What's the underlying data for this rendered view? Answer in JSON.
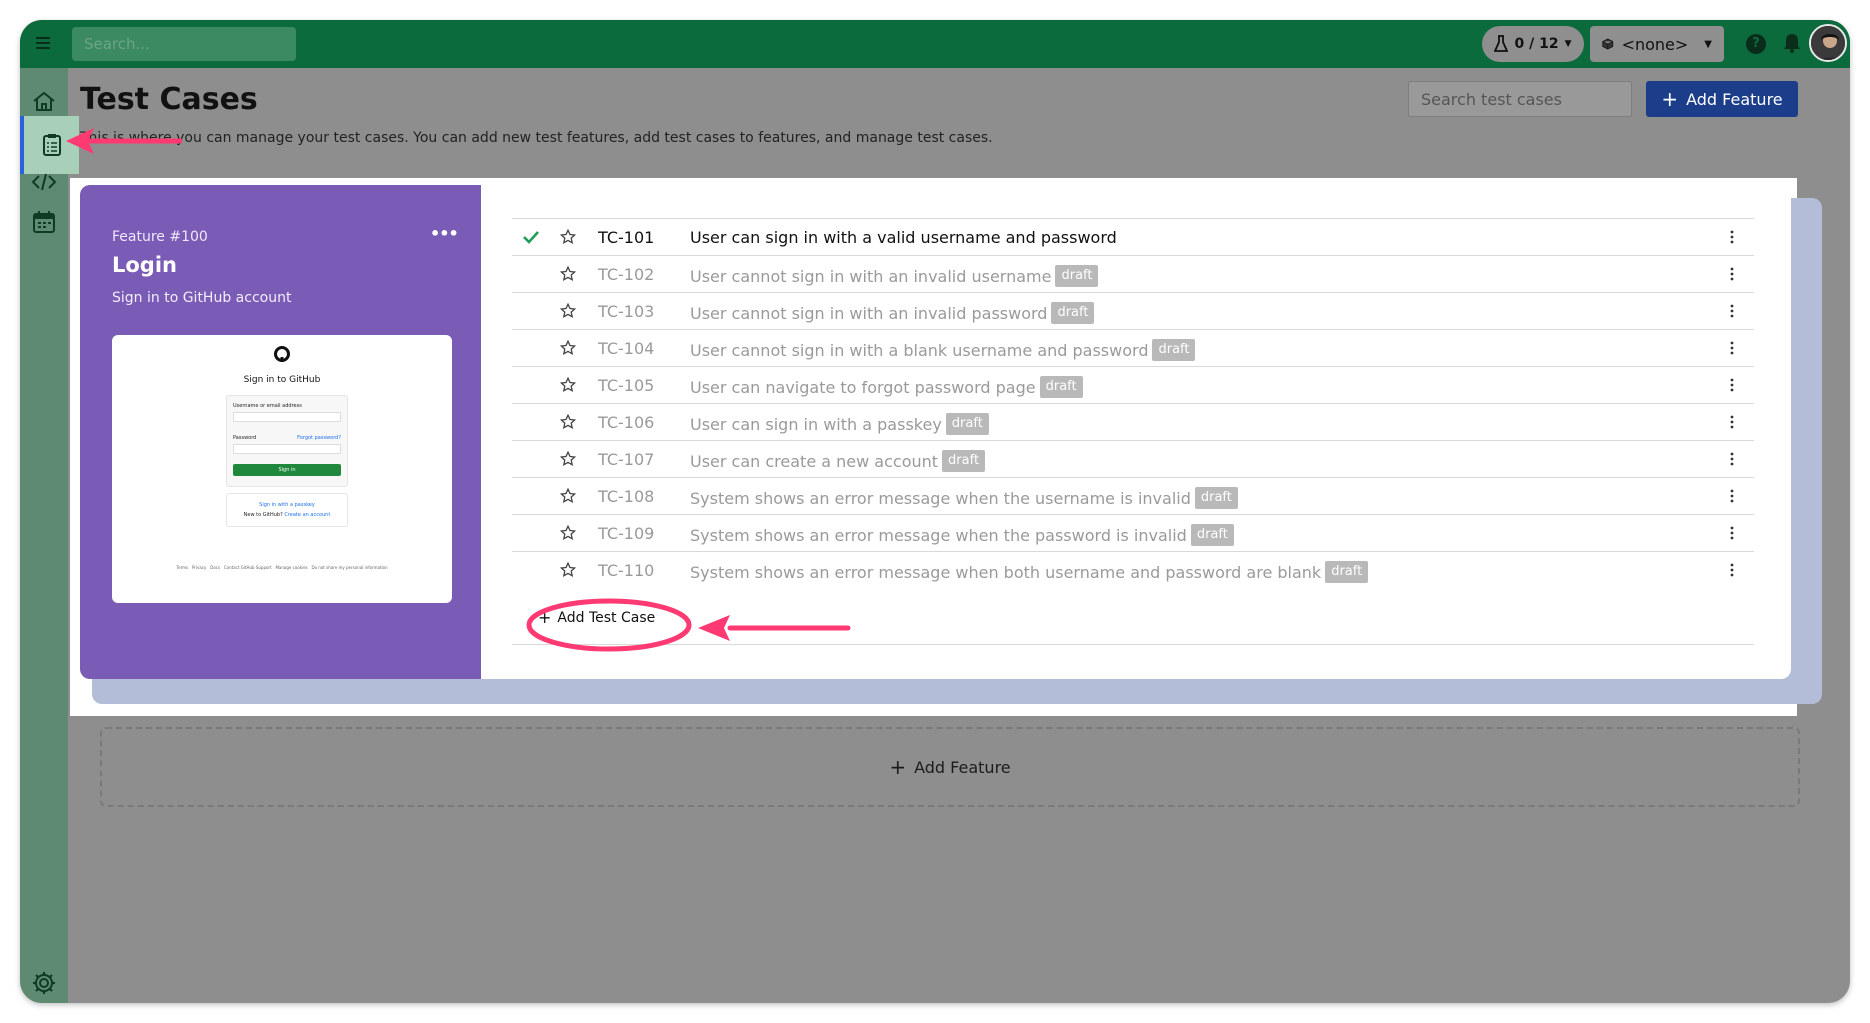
{
  "topbar": {
    "search_placeholder": "Search...",
    "runs_label": "0 / 12",
    "environment_label": "<none>",
    "help_label": "?"
  },
  "sidebar": {
    "items": [
      {
        "name": "home",
        "icon": "home-icon"
      },
      {
        "name": "test-cases",
        "icon": "clipboard-icon",
        "active": true
      },
      {
        "name": "code",
        "icon": "code-icon"
      },
      {
        "name": "calendar",
        "icon": "calendar-icon"
      },
      {
        "name": "settings",
        "icon": "gear-icon"
      }
    ]
  },
  "page": {
    "title": "Test Cases",
    "description": "This is where you can manage your test cases. You can add new test features, add test cases to features, and manage test cases.",
    "search_placeholder": "Search test cases",
    "add_feature_label": "Add Feature"
  },
  "feature": {
    "id_label": "Feature #100",
    "name": "Login",
    "description": "Sign in to GitHub account",
    "preview": {
      "heading": "Sign in to GitHub",
      "username_label": "Username or email address",
      "password_label": "Password",
      "forgot_label": "Forgot password?",
      "signin_button": "Sign in",
      "passkey_label": "Sign in with a passkey",
      "new_text": "New to GitHub?",
      "create_label": "Create an account",
      "footer_links": "Terms   Privacy   Docs   Contact GitHub Support   Manage cookies   Do not share my personal information"
    }
  },
  "test_cases": [
    {
      "id": "TC-101",
      "title": "User can sign in with a valid username and password",
      "status": "ready",
      "badge": ""
    },
    {
      "id": "TC-102",
      "title": "User cannot sign in with an invalid username",
      "status": "draft",
      "badge": "draft"
    },
    {
      "id": "TC-103",
      "title": "User cannot sign in with an invalid password",
      "status": "draft",
      "badge": "draft"
    },
    {
      "id": "TC-104",
      "title": "User cannot sign in with a blank username and password",
      "status": "draft",
      "badge": "draft"
    },
    {
      "id": "TC-105",
      "title": "User can navigate to forgot password page",
      "status": "draft",
      "badge": "draft"
    },
    {
      "id": "TC-106",
      "title": "User can sign in with a passkey",
      "status": "draft",
      "badge": "draft"
    },
    {
      "id": "TC-107",
      "title": "User can create a new account",
      "status": "draft",
      "badge": "draft"
    },
    {
      "id": "TC-108",
      "title": "System shows an error message when the username is invalid",
      "status": "draft",
      "badge": "draft"
    },
    {
      "id": "TC-109",
      "title": "System shows an error message when the password is invalid",
      "status": "draft",
      "badge": "draft"
    },
    {
      "id": "TC-110",
      "title": "System shows an error message when both username and password are blank",
      "status": "draft",
      "badge": "draft"
    }
  ],
  "add_test_case_label": "Add Test Case",
  "add_feature_bottom_label": "Add Feature",
  "colors": {
    "topbar": "#0b6b3c",
    "sidebar": "#5e8a72",
    "feature_panel": "#7a5bb5",
    "primary_button": "#1b3d8a",
    "annotation": "#ff3a73"
  }
}
